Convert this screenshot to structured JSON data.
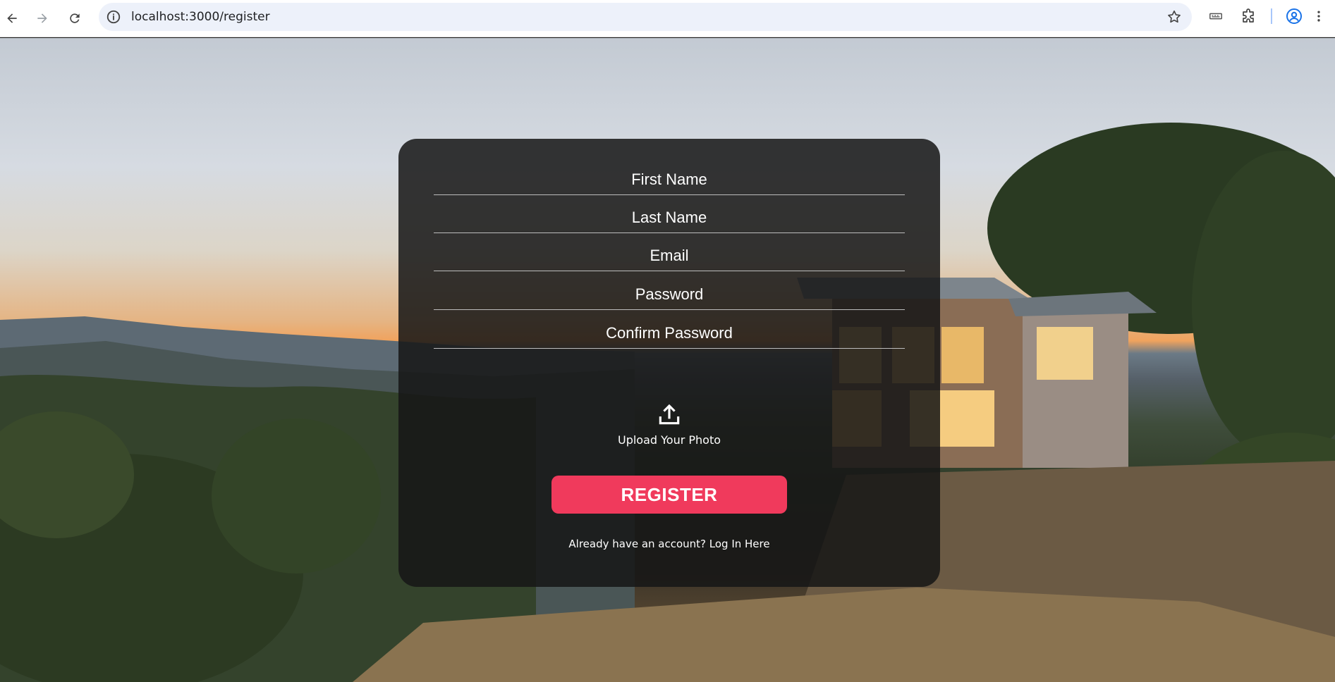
{
  "browser": {
    "url": "localhost:3000/register",
    "back_icon": "arrow-left-icon",
    "forward_icon": "arrow-right-icon",
    "reload_icon": "reload-icon"
  },
  "form": {
    "first_name_placeholder": "First Name",
    "last_name_placeholder": "Last Name",
    "email_placeholder": "Email",
    "password_placeholder": "Password",
    "confirm_password_placeholder": "Confirm Password",
    "upload_label": "Upload Your Photo",
    "register_label": "REGISTER",
    "login_text": "Already have an account? Log In Here"
  },
  "colors": {
    "accent": "#f03a5c",
    "card_background": "#161616"
  }
}
